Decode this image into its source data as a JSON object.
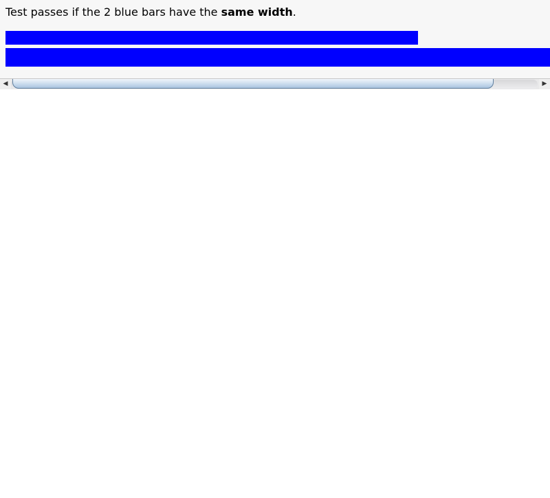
{
  "instruction": {
    "prefix": "Test passes if the 2 blue bars have the ",
    "emphasis": "same width",
    "suffix": "."
  },
  "colors": {
    "bar": "#0000ff",
    "frame_background": "#f7f7f7",
    "scrollbar_thumb": "#c7d9ec"
  },
  "scrollbar": {
    "left_arrow_icon": "◀",
    "right_arrow_icon": "▶"
  }
}
